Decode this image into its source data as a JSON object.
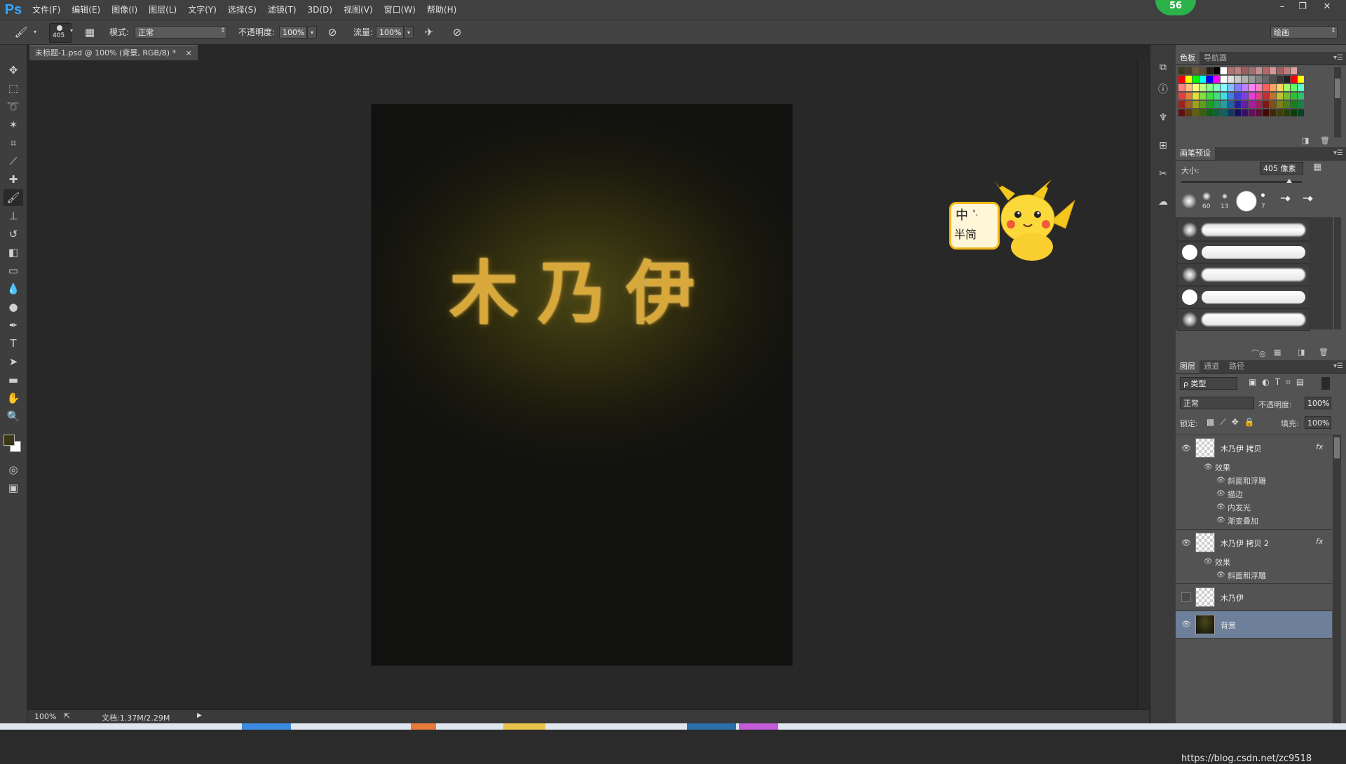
{
  "menu": {
    "logo": "Ps",
    "items": [
      "文件(F)",
      "编辑(E)",
      "图像(I)",
      "图层(L)",
      "文字(Y)",
      "选择(S)",
      "滤镜(T)",
      "3D(D)",
      "视图(V)",
      "窗口(W)",
      "帮助(H)"
    ],
    "badge": "56",
    "window_controls": [
      "–",
      "❐",
      "✕"
    ]
  },
  "options": {
    "brush_size": "405",
    "mode_label": "模式:",
    "mode_value": "正常",
    "opacity_label": "不透明度:",
    "opacity_value": "100%",
    "flow_label": "流量:",
    "flow_value": "100%",
    "workspace": "绘画"
  },
  "document": {
    "tab_title": "未标题-1.psd @ 100% (背景, RGB/8) *",
    "tab_close": "×",
    "canvas_text": "木乃伊",
    "zoom": "100%",
    "doc_info": "文档:1.37M/2.29M"
  },
  "ime": {
    "line1": "中",
    "line2": "半简",
    "mark": "°,"
  },
  "swatches": {
    "tabs": [
      "色板",
      "导航器"
    ],
    "colors_row1": [
      "#3b3a1e",
      "#4a3b2c",
      "#6a5a36",
      "#5b4a3a",
      "#2a1e14",
      "#000000",
      "#ffffff",
      "#b07070",
      "#c08080",
      "#9a6060",
      "#a07070",
      "#c09090",
      "#b06868",
      "#d09898",
      "#a06060",
      "#c07878",
      "#e0a0a0"
    ],
    "colors_row2": [
      "#ff0000",
      "#ffff00",
      "#00ff00",
      "#00ffff",
      "#0000ff",
      "#ff00ff",
      "#ffffff",
      "#e0e0e0",
      "#c8c8c8",
      "#b0b0b0",
      "#989898",
      "#808080",
      "#686868",
      "#505050",
      "#383838",
      "#202020",
      "#ff0000",
      "#ffff00"
    ],
    "colors_row3": [
      "#ff8080",
      "#ffc080",
      "#ffff80",
      "#c0ff80",
      "#80ff80",
      "#80ffc0",
      "#80ffff",
      "#80c0ff",
      "#8080ff",
      "#c080ff",
      "#ff80ff",
      "#ff80c0",
      "#ff6060",
      "#ffa060",
      "#ffd060",
      "#a0ff60",
      "#60ff60",
      "#60ffd0"
    ],
    "colors_row4": [
      "#e04040",
      "#e08040",
      "#e0e040",
      "#80e040",
      "#40e040",
      "#40e080",
      "#40e0e0",
      "#4080e0",
      "#4040e0",
      "#8040e0",
      "#e040e0",
      "#e04080",
      "#c03030",
      "#c07030",
      "#c0c030",
      "#70c030",
      "#30c030",
      "#30c070"
    ],
    "colors_row5": [
      "#a02020",
      "#a06020",
      "#a0a020",
      "#60a020",
      "#20a020",
      "#20a060",
      "#20a0a0",
      "#2060a0",
      "#2020a0",
      "#6020a0",
      "#a020a0",
      "#a02060",
      "#801818",
      "#805018",
      "#808018",
      "#508018",
      "#188018",
      "#188050"
    ],
    "colors_row6": [
      "#601010",
      "#603810",
      "#606010",
      "#386010",
      "#106010",
      "#106038",
      "#106060",
      "#103860",
      "#101060",
      "#381060",
      "#601060",
      "#601038",
      "#400808",
      "#402808",
      "#404008",
      "#284008",
      "#084008",
      "#084028"
    ]
  },
  "brushes": {
    "tabs": [
      "画笔预设"
    ],
    "size_label": "大小:",
    "size_value": "405 像素",
    "tip_sizes": [
      "60",
      "13",
      "",
      "7",
      "",
      ""
    ]
  },
  "layers": {
    "tabs": [
      "图层",
      "通道",
      "路径"
    ],
    "filter_label": "ρ 类型",
    "blend_mode": "正常",
    "opacity_label": "不透明度:",
    "opacity_value": "100%",
    "lock_label": "锁定:",
    "fill_label": "填充:",
    "fill_value": "100%",
    "fx_label": "fx",
    "items": [
      {
        "name": "木乃伊 拷贝",
        "effects_label": "效果",
        "effects": [
          "斜面和浮雕",
          "描边",
          "内发光",
          "渐变叠加"
        ]
      },
      {
        "name": "木乃伊 拷贝 2",
        "effects_label": "效果",
        "effects": [
          "斜面和浮雕"
        ]
      },
      {
        "name": "木乃伊"
      },
      {
        "name": "背景"
      }
    ]
  },
  "watermark": "https://blog.csdn.net/zc9518"
}
